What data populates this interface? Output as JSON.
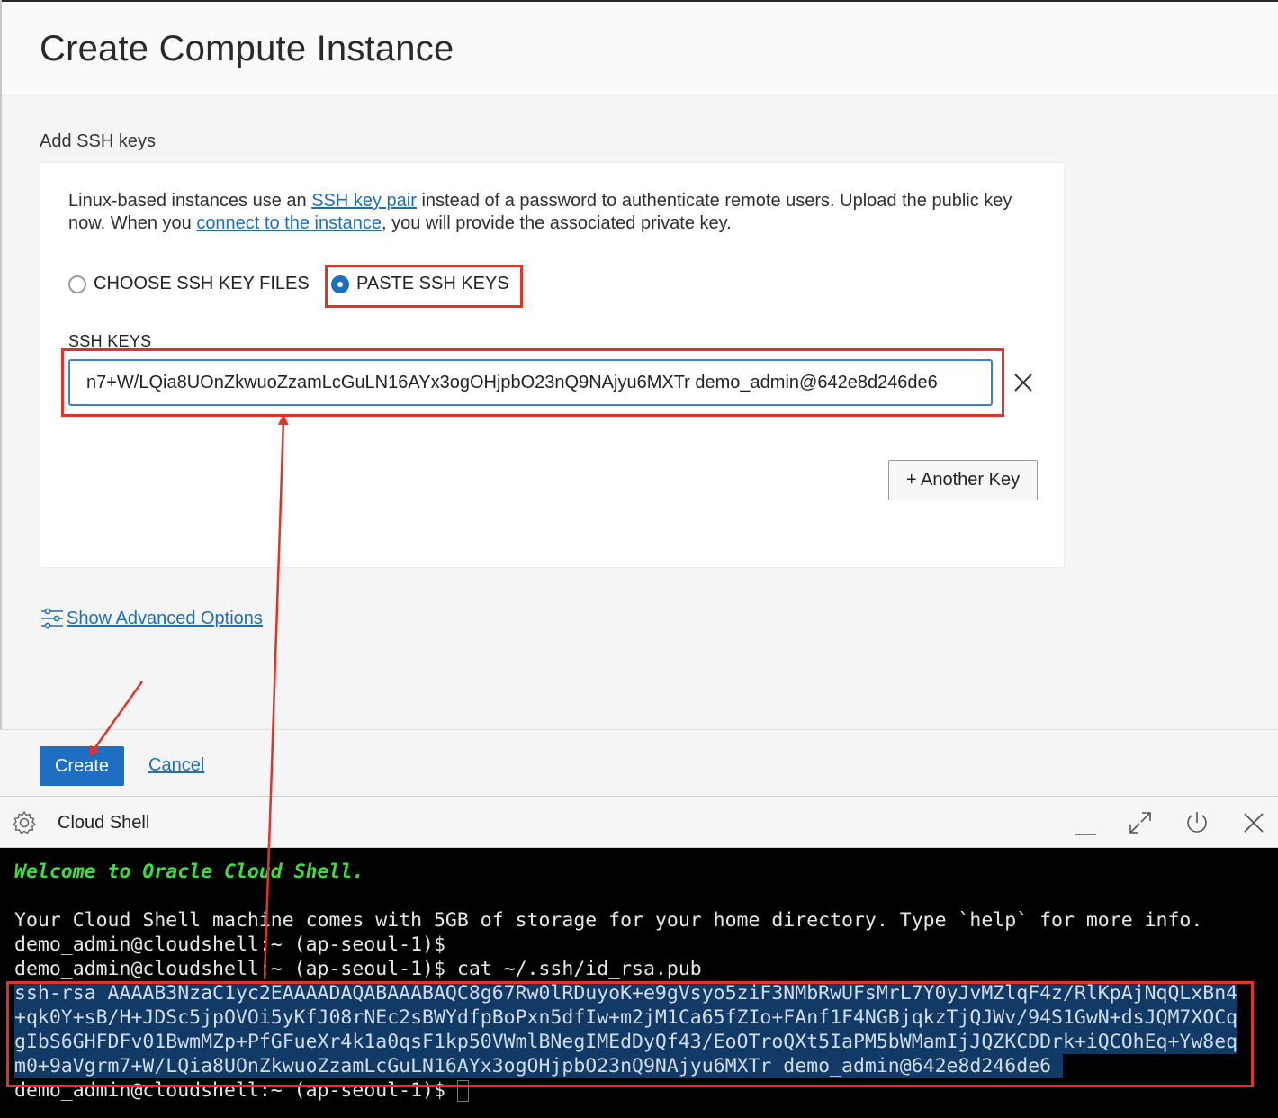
{
  "header": {
    "title": "Create Compute Instance"
  },
  "ssh_section": {
    "label": "Add SSH keys",
    "description": {
      "part1": "Linux-based instances use an ",
      "link1": "SSH key pair",
      "part2": " instead of a password to authenticate remote users. Upload the public key now. When you ",
      "link2": "connect to the instance",
      "part3": ", you will provide the associated private key."
    },
    "options": {
      "choose_files": "CHOOSE SSH KEY FILES",
      "paste_keys": "PASTE SSH KEYS",
      "selected": "paste_keys"
    },
    "keys_label": "SSH KEYS",
    "key_value": "n7+W/LQia8UOnZkwuoZzamLcGuLN16AYx3ogOHjpbO23nQ9NAjyu6MXTr demo_admin@642e8d246de6",
    "another_key_button": "+ Another Key"
  },
  "advanced_link": "Show Advanced Options",
  "footer": {
    "create_button": "Create",
    "cancel_link": "Cancel"
  },
  "cloud_shell": {
    "title": "Cloud Shell",
    "icons": [
      "gear-icon",
      "minimize-icon",
      "expand-icon",
      "restart-icon",
      "close-icon"
    ],
    "terminal": {
      "welcome": "Welcome to Oracle Cloud Shell.",
      "info": "Your Cloud Shell machine comes with 5GB of storage for your home directory. Type `help` for more info.",
      "prompt1": "demo_admin@cloudshell:~ (ap-seoul-1)$",
      "prompt2": "demo_admin@cloudshell:~ (ap-seoul-1)$ cat ~/.ssh/id_rsa.pub",
      "key_line1": "ssh-rsa AAAAB3NzaC1yc2EAAAADAQABAAABAQC8g67Rw0lRDuyoK+e9gVsyo5ziF3NMbRwUFsMrL7Y0yJvMZlqF4z/RlKpAjNqQLxBn4",
      "key_line2": "+qk0Y+sB/H+JDSc5jpOVOi5yKfJ08rNEc2sBWYdfpBoPxn5dfIw+m2jM1Ca65fZIo+FAnf1F4NGBjqkzTjQJWv/94S1GwN+dsJQM7XOCq",
      "key_line3": "gIbS6GHFDFv01BwmMZp+PfGFueXr4k1a0qsF1kp50VWmlBNegIMEdDyQf43/EoOTroQXt5IaPM5bWMamIjJQZKCDDrk+iQCOhEq+Yw8eq",
      "key_line4": "m0+9aVgrm7+W/LQia8UOnZkwuoZzamLcGuLN16AYx3ogOHjpbO23nQ9NAjyu6MXTr demo_admin@642e8d246de6 ",
      "prompt3": "demo_admin@cloudshell:~ (ap-seoul-1)$ "
    }
  },
  "colors": {
    "accent": "#1e6fc2",
    "link": "#1f6fb5",
    "annotation_red": "#e0342b",
    "terminal_bg": "#000000",
    "terminal_green": "#3fdc3f",
    "selection": "#113a66"
  }
}
